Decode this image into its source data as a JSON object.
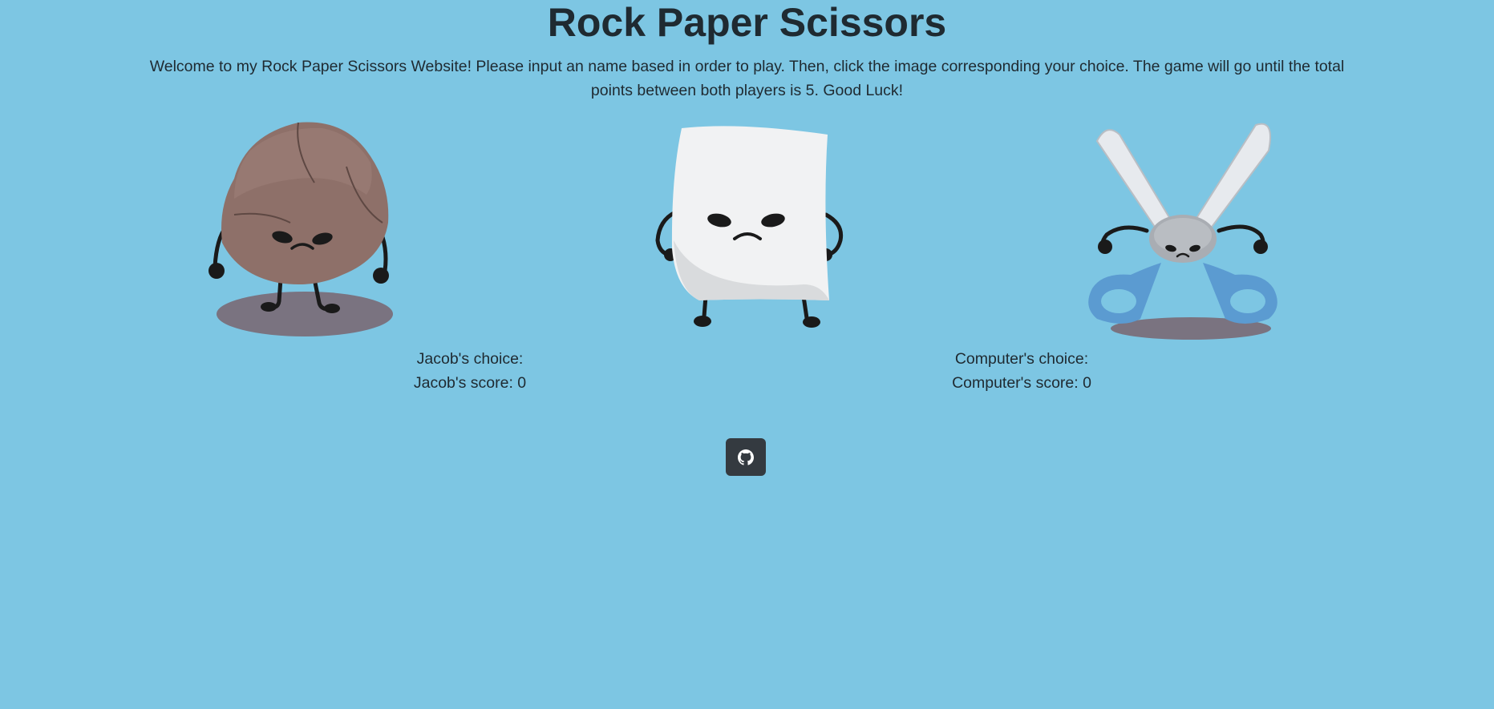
{
  "page": {
    "title": "Rock Paper Scissors",
    "intro": "Welcome to my Rock Paper Scissors Website! Please input an name based in order to play. Then, click the image corresponding your choice. The game will go until the total points between both players is 5. Good Luck!"
  },
  "choices": [
    {
      "id": "rock",
      "icon": "rock-character-icon"
    },
    {
      "id": "paper",
      "icon": "paper-character-icon"
    },
    {
      "id": "scissors",
      "icon": "scissors-character-icon"
    }
  ],
  "player": {
    "choice_label": "Jacob's choice:",
    "score_label": "Jacob's score: 0"
  },
  "computer": {
    "choice_label": "Computer's choice:",
    "score_label": "Computer's score: 0"
  },
  "footer": {
    "github_icon": "github-icon"
  },
  "colors": {
    "background": "#7dc6e3",
    "text": "#1f2a31",
    "button": "#343a40"
  }
}
